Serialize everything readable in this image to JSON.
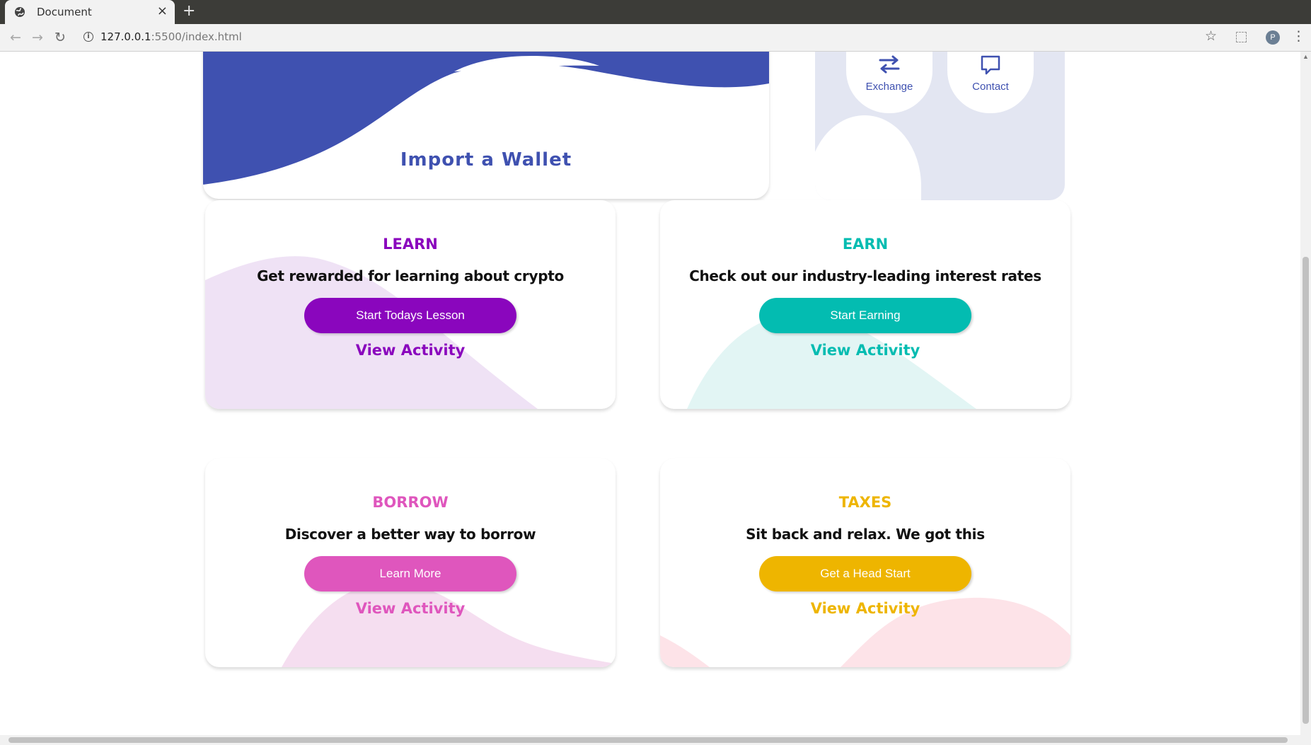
{
  "browser": {
    "tab_title": "Document",
    "tab_close": "×",
    "new_tab": "+",
    "url_host": "127.0.0.1",
    "url_path": ":5500/index.html",
    "nav_back": "←",
    "nav_forward": "→",
    "nav_reload": "↻",
    "bookmark_star": "☆",
    "profile_initial": "P",
    "menu": "⋮"
  },
  "wallet": {
    "import_label": "Import a Wallet"
  },
  "quick_actions": [
    {
      "label": "Exchange",
      "icon": "exchange-arrows-icon"
    },
    {
      "label": "Contact",
      "icon": "chat-bubble-icon"
    }
  ],
  "cards": {
    "learn": {
      "title": "LEARN",
      "description": "Get rewarded for learning about crypto",
      "button": "Start Todays Lesson",
      "link": "View Activity",
      "color": "#8a06bd"
    },
    "earn": {
      "title": "EARN",
      "description": "Check out our industry-leading interest rates",
      "button": "Start Earning",
      "link": "View Activity",
      "color": "#03bcb1"
    },
    "borrow": {
      "title": "BORROW",
      "description": "Discover a better way to borrow",
      "button": "Learn More",
      "link": "View Activity",
      "color": "#df56bd"
    },
    "taxes": {
      "title": "TAXES",
      "description": "Sit back and relax. We got this",
      "button": "Get a Head Start",
      "link": "View Activity",
      "color": "#eeb500"
    }
  },
  "colors": {
    "brand_blue": "#3f51b0",
    "panel_bg": "#e3e6f2"
  }
}
